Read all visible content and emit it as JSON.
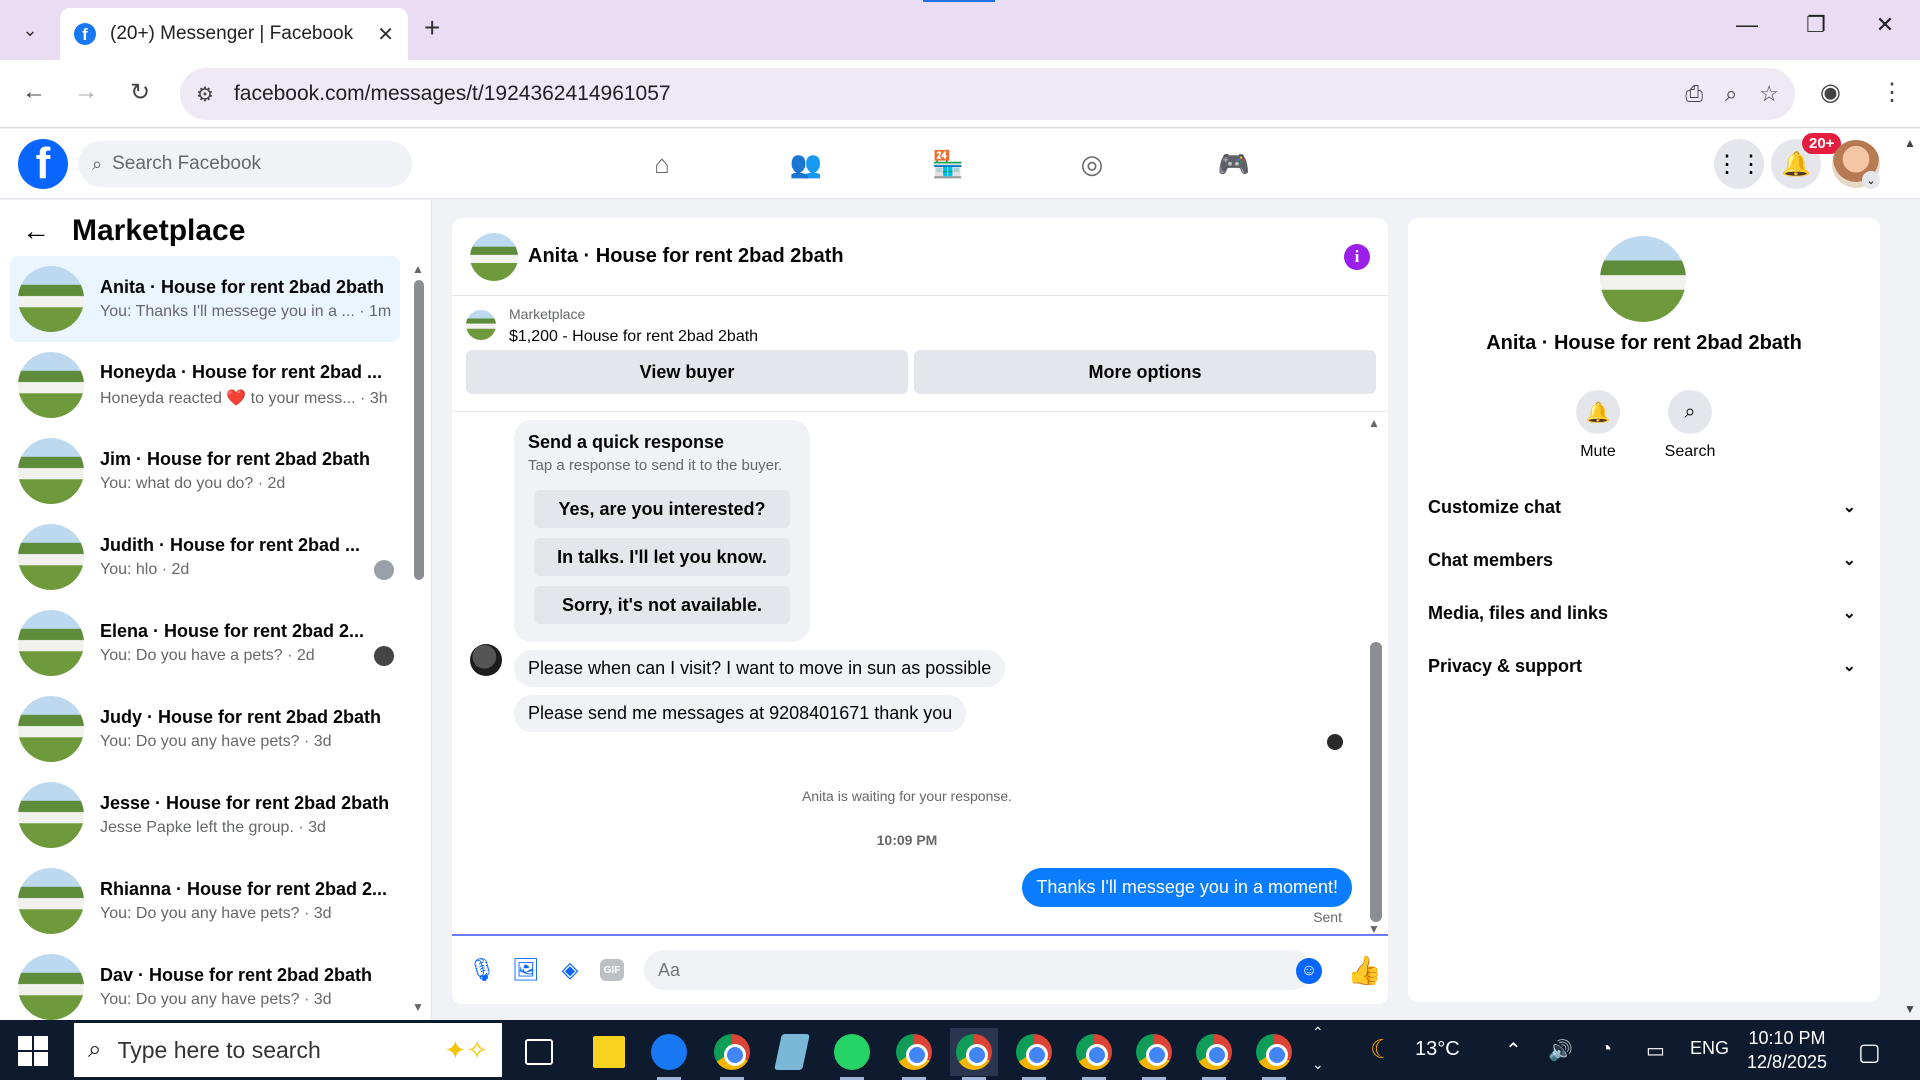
{
  "browser": {
    "tab_title": "(20+) Messenger | Facebook",
    "url": "facebook.com/messages/t/1924362414961057"
  },
  "fb": {
    "search_placeholder": "Search Facebook",
    "notifications_badge": "20+"
  },
  "sidebar": {
    "title": "Marketplace",
    "conversations": [
      {
        "name": "Anita · House for rent 2bad 2bath",
        "preview": "You: Thanks I'll messege you in a ... · 1m",
        "active": true
      },
      {
        "name": "Honeyda · House for rent 2bad ...",
        "preview": "Honeyda reacted ❤️ to your mess... · 3h"
      },
      {
        "name": "Jim · House for rent 2bad 2bath",
        "preview": "You: what do you do? · 2d"
      },
      {
        "name": "Judith · House for rent 2bad ...",
        "preview": "You: hlo · 2d"
      },
      {
        "name": "Elena · House for rent 2bad 2...",
        "preview": "You: Do you have a pets? · 2d"
      },
      {
        "name": "Judy · House for rent 2bad 2bath",
        "preview": "You: Do you any have pets? · 3d"
      },
      {
        "name": "Jesse · House for rent 2bad 2bath",
        "preview": "Jesse Papke left the group. · 3d"
      },
      {
        "name": "Rhianna · House for rent 2bad 2...",
        "preview": "You: Do you any have pets? · 3d"
      },
      {
        "name": "Dav · House for rent 2bad 2bath",
        "preview": "You: Do you any have pets? · 3d"
      }
    ]
  },
  "chat": {
    "title": "Anita · House for rent 2bad 2bath",
    "marketplace_label": "Marketplace",
    "listing": "$1,200 - House for rent 2bad 2bath",
    "view_buyer": "View buyer",
    "more_options": "More options",
    "quick_title": "Send a quick response",
    "quick_subtitle": "Tap a response to send it to the buyer.",
    "quick_responses": [
      "Yes, are you interested?",
      "In talks. I'll let you know.",
      "Sorry, it's not available."
    ],
    "msg1": "Please when can I visit? I want to move in sun as possible",
    "msg2": "Please send me messages at 9208401671 thank you",
    "waiting": "Anita is waiting for your response.",
    "time": "10:09 PM",
    "outgoing": "Thanks I'll messege you in a moment!",
    "sent": "Sent",
    "input_placeholder": "Aa"
  },
  "info": {
    "name": "Anita · House for rent 2bad 2bath",
    "mute": "Mute",
    "search": "Search",
    "sections": [
      "Customize chat",
      "Chat members",
      "Media, files and links",
      "Privacy & support"
    ]
  },
  "taskbar": {
    "search_placeholder": "Type here to search",
    "weather": "13°C",
    "lang": "ENG",
    "time": "10:10 PM",
    "date": "12/8/2025"
  }
}
